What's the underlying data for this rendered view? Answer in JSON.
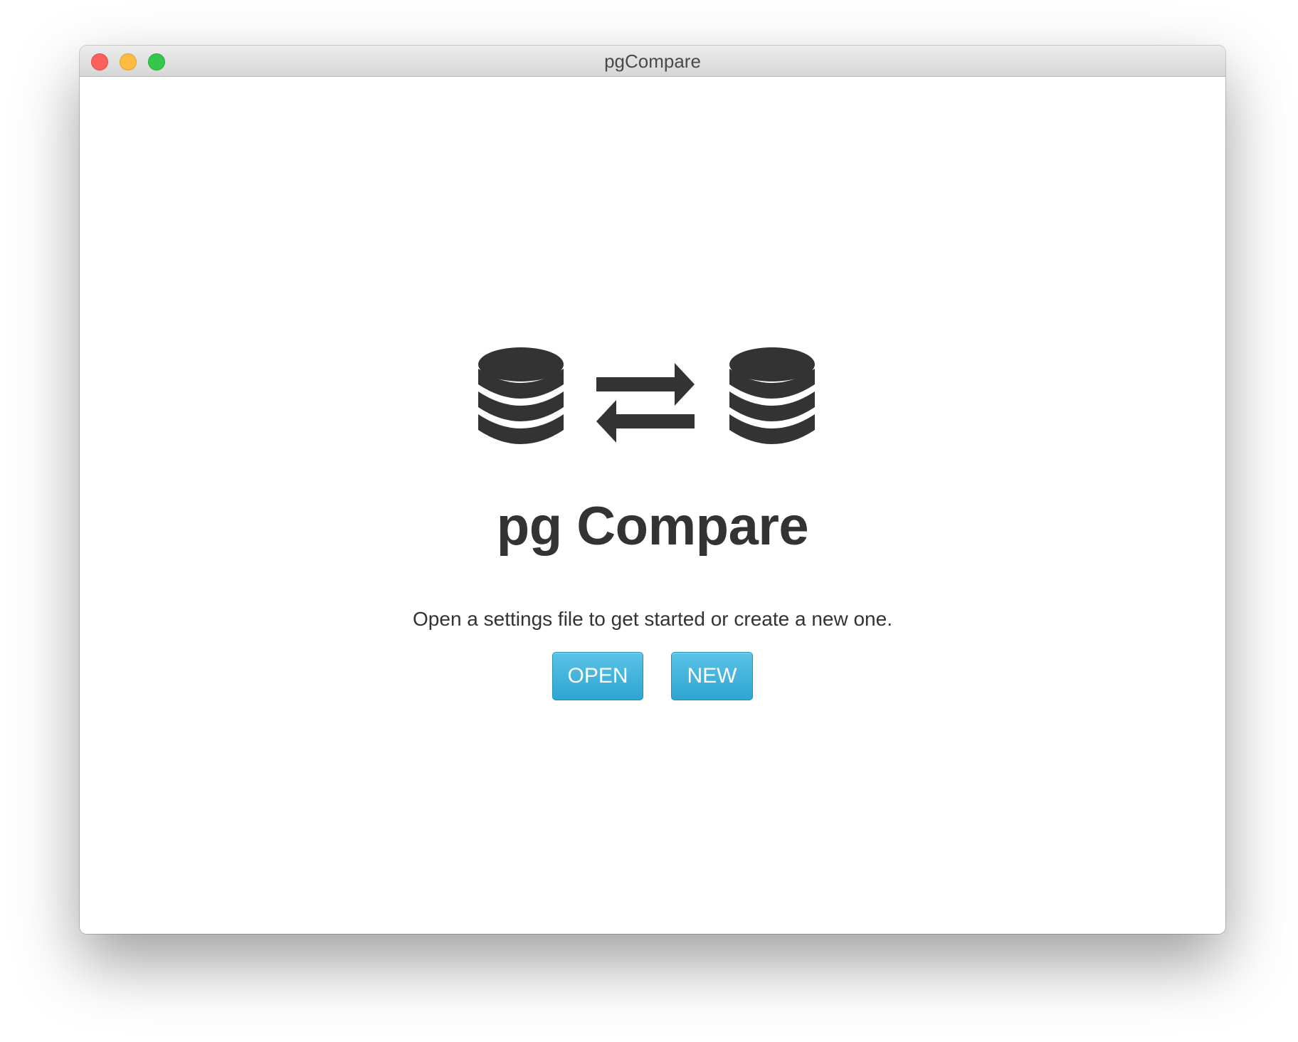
{
  "window": {
    "title": "pgCompare"
  },
  "hero": {
    "left_icon": "database-icon",
    "middle_icon": "exchange-arrows-icon",
    "right_icon": "database-icon",
    "title": "pg Compare",
    "subtitle": "Open a settings file to get started or create a new one."
  },
  "actions": {
    "open_label": "OPEN",
    "new_label": "NEW"
  },
  "colors": {
    "icon": "#333333",
    "button_top": "#5bc3e6",
    "button_bottom": "#2ea5d2",
    "close": "#fc605c",
    "minimize": "#fdbc40",
    "zoom": "#34c84a"
  }
}
